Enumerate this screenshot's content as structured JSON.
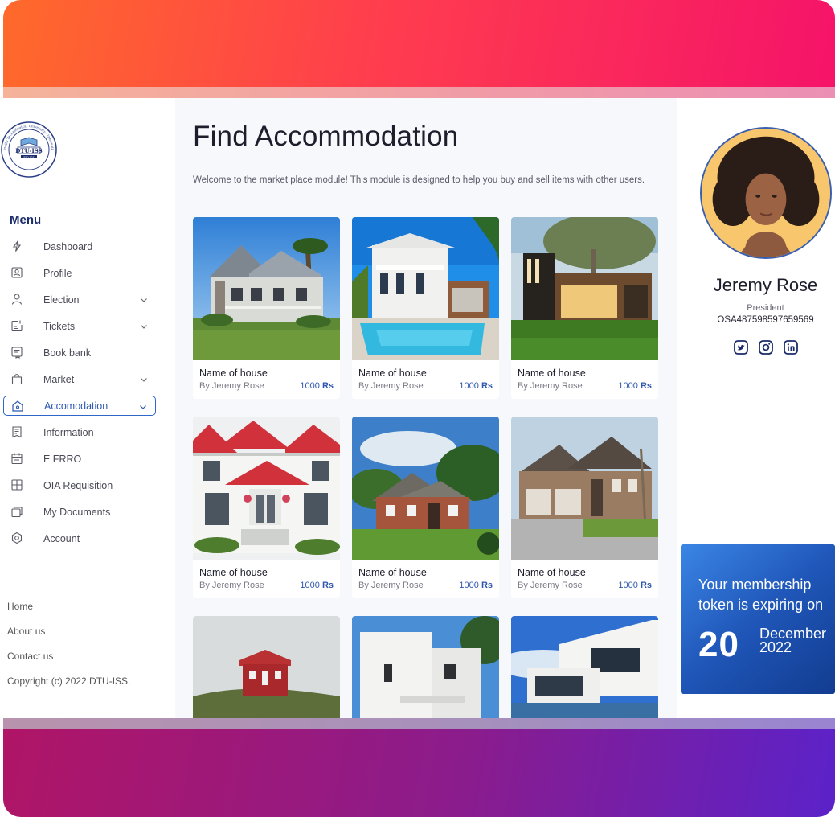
{
  "logo": {
    "text": "DTU-ISS",
    "estd": "ESTD 2021",
    "ring_text": "Delhi Technological University · International Students Society"
  },
  "sidebar": {
    "menu_title": "Menu",
    "items": [
      {
        "label": "Dashboard",
        "icon": "bolt-icon",
        "chevron": false,
        "active": false
      },
      {
        "label": "Profile",
        "icon": "profile-card-icon",
        "chevron": false,
        "active": false
      },
      {
        "label": "Election",
        "icon": "user-icon",
        "chevron": true,
        "active": false
      },
      {
        "label": "Tickets",
        "icon": "ticket-icon",
        "chevron": true,
        "active": false
      },
      {
        "label": "Book bank",
        "icon": "book-icon",
        "chevron": false,
        "active": false
      },
      {
        "label": "Market",
        "icon": "bag-icon",
        "chevron": true,
        "active": false
      },
      {
        "label": "Accomodation",
        "icon": "home-icon",
        "chevron": true,
        "active": true
      },
      {
        "label": "Information",
        "icon": "document-icon",
        "chevron": false,
        "active": false
      },
      {
        "label": "E FRRO",
        "icon": "calendar-icon",
        "chevron": false,
        "active": false
      },
      {
        "label": "OIA Requisition",
        "icon": "grid-icon",
        "chevron": false,
        "active": false
      },
      {
        "label": "My Documents",
        "icon": "folder-icon",
        "chevron": false,
        "active": false
      },
      {
        "label": "Account",
        "icon": "settings-icon",
        "chevron": false,
        "active": false
      }
    ],
    "footer": [
      "Home",
      "About us",
      "Contact us",
      "Copyright (c) 2022 DTU-ISS."
    ]
  },
  "main": {
    "title": "Find Accommodation",
    "description": "Welcome to the market place module! This module is designed to help you buy and sell items with other users.",
    "cards": [
      {
        "name": "Name of house",
        "owner": "By Jeremy Rose",
        "price_amount": "1000",
        "price_unit": "Rs",
        "photo": "grey-cottage-photo"
      },
      {
        "name": "Name of house",
        "owner": "By Jeremy Rose",
        "price_amount": "1000",
        "price_unit": "Rs",
        "photo": "white-villa-pool-photo"
      },
      {
        "name": "Name of house",
        "owner": "By Jeremy Rose",
        "price_amount": "1000",
        "price_unit": "Rs",
        "photo": "modern-wood-house-photo"
      },
      {
        "name": "Name of house",
        "owner": "By Jeremy Rose",
        "price_amount": "1000",
        "price_unit": "Rs",
        "photo": "white-red-roof-house-photo"
      },
      {
        "name": "Name of house",
        "owner": "By Jeremy Rose",
        "price_amount": "1000",
        "price_unit": "Rs",
        "photo": "brick-house-lawn-photo"
      },
      {
        "name": "Name of house",
        "owner": "By Jeremy Rose",
        "price_amount": "1000",
        "price_unit": "Rs",
        "photo": "stone-mansion-photo"
      },
      {
        "name": "",
        "owner": "",
        "price_amount": "",
        "price_unit": "",
        "photo": "red-hut-hill-photo"
      },
      {
        "name": "",
        "owner": "",
        "price_amount": "",
        "price_unit": "",
        "photo": "white-block-house-photo"
      },
      {
        "name": "",
        "owner": "",
        "price_amount": "",
        "price_unit": "",
        "photo": "modern-glass-villa-photo"
      }
    ]
  },
  "profile": {
    "name": "Jeremy Rose",
    "role": "President",
    "id": "OSA487598597659569",
    "socials": [
      "twitter-icon",
      "instagram-icon",
      "linkedin-icon"
    ]
  },
  "token": {
    "message": "Your membership token is expiring on",
    "day": "20",
    "month": "December",
    "year": "2022"
  },
  "colors": {
    "accent": "#2f58b0",
    "top_band": "#ff3d4e",
    "bottom_band": "#8b1c8c",
    "token_bg": "#1f56b8"
  }
}
